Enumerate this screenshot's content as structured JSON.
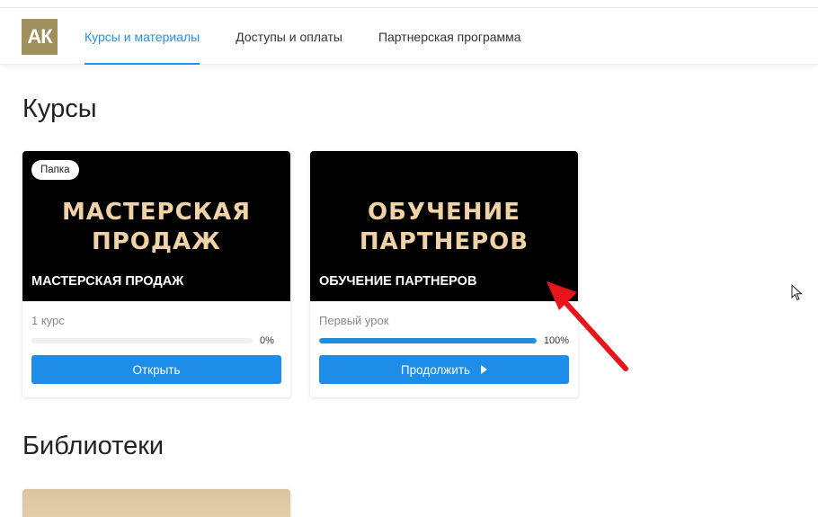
{
  "header": {
    "logo_text": "АК",
    "nav": [
      {
        "label": "Курсы и материалы",
        "active": true
      },
      {
        "label": "Доступы и оплаты",
        "active": false
      },
      {
        "label": "Партнерская программа",
        "active": false
      }
    ]
  },
  "sections": {
    "courses_title": "Курсы",
    "libraries_title": "Библиотеки"
  },
  "cards": [
    {
      "badge": "Папка",
      "cover_line1": "МАСТЕРСКАЯ",
      "cover_line2": "ПРОДАЖ",
      "caption": "МАСТЕРСКАЯ ПРОДАЖ",
      "subtitle": "1 курс",
      "progress_percent": 0,
      "progress_label": "0%",
      "button_label": "Открыть"
    },
    {
      "cover_line1": "ОБУЧЕНИЕ",
      "cover_line2": "ПАРТНЕРОВ",
      "caption": "ОБУЧЕНИЕ ПАРТНЕРОВ",
      "subtitle": "Первый урок",
      "progress_percent": 100,
      "progress_label": "100%",
      "button_label": "Продолжить"
    }
  ],
  "colors": {
    "accent": "#1e8de8",
    "logo_bg": "#a0905e",
    "cover_text": "#f1d2a6",
    "annotation_arrow": "#e8141b"
  },
  "icons": {
    "continue_button_icon": "play-icon",
    "annotation": "red-arrow-icon",
    "cursor": "mouse-pointer-icon"
  }
}
